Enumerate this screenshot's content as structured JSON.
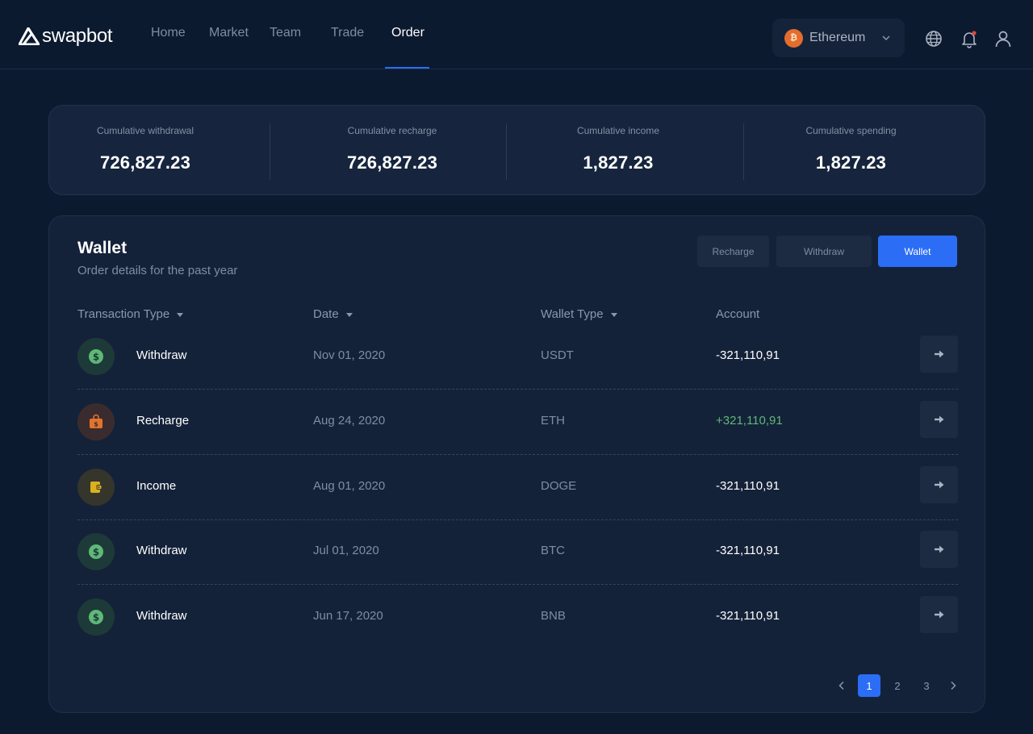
{
  "brand": {
    "name": "swapbot"
  },
  "nav": [
    {
      "label": "Home",
      "active": false
    },
    {
      "label": "Market",
      "active": false
    },
    {
      "label": "Team",
      "active": false
    },
    {
      "label": "Trade",
      "active": false
    },
    {
      "label": "Order",
      "active": true
    }
  ],
  "network": {
    "selected": "Ethereum",
    "coin_glyph": "₿",
    "coin_color": "#e46c2c"
  },
  "header_icons": [
    "globe-icon",
    "bell-icon",
    "user-icon"
  ],
  "stats": [
    {
      "label": "Cumulative withdrawal",
      "value": "726,827.23"
    },
    {
      "label": "Cumulative recharge",
      "value": "726,827.23"
    },
    {
      "label": "Cumulative income",
      "value": "1,827.23"
    },
    {
      "label": "Cumulative spending",
      "value": "1,827.23"
    }
  ],
  "wallet": {
    "title": "Wallet",
    "subtitle": "Order details for the past year",
    "tabs": [
      {
        "label": "Recharge",
        "active": false
      },
      {
        "label": "Withdraw",
        "active": false
      },
      {
        "label": "Wallet",
        "active": true
      }
    ],
    "columns": {
      "type": "Transaction Type",
      "date": "Date",
      "wallet_type": "Wallet Type",
      "account": "Account"
    },
    "rows": [
      {
        "type": "Withdraw",
        "icon": "dollar-icon",
        "date": "Nov 01, 2020",
        "wallet_type": "USDT",
        "account": "-321,110,91"
      },
      {
        "type": "Recharge",
        "icon": "bag-icon",
        "date": "Aug 24, 2020",
        "wallet_type": "ETH",
        "account": "+321,110,91"
      },
      {
        "type": "Income",
        "icon": "wallet-icon",
        "date": "Aug 01, 2020",
        "wallet_type": "DOGE",
        "account": "-321,110,91"
      },
      {
        "type": "Withdraw",
        "icon": "dollar-icon",
        "date": "Jul 01, 2020",
        "wallet_type": "BTC",
        "account": "-321,110,91"
      },
      {
        "type": "Withdraw",
        "icon": "dollar-icon",
        "date": "Jun 17, 2020",
        "wallet_type": "BNB",
        "account": "-321,110,91"
      }
    ]
  },
  "pagination": {
    "pages": [
      "1",
      "2",
      "3"
    ],
    "current": "1"
  },
  "colors": {
    "accent": "#2b6ef5",
    "positive": "#5fb878",
    "background": "#0c1a30"
  }
}
